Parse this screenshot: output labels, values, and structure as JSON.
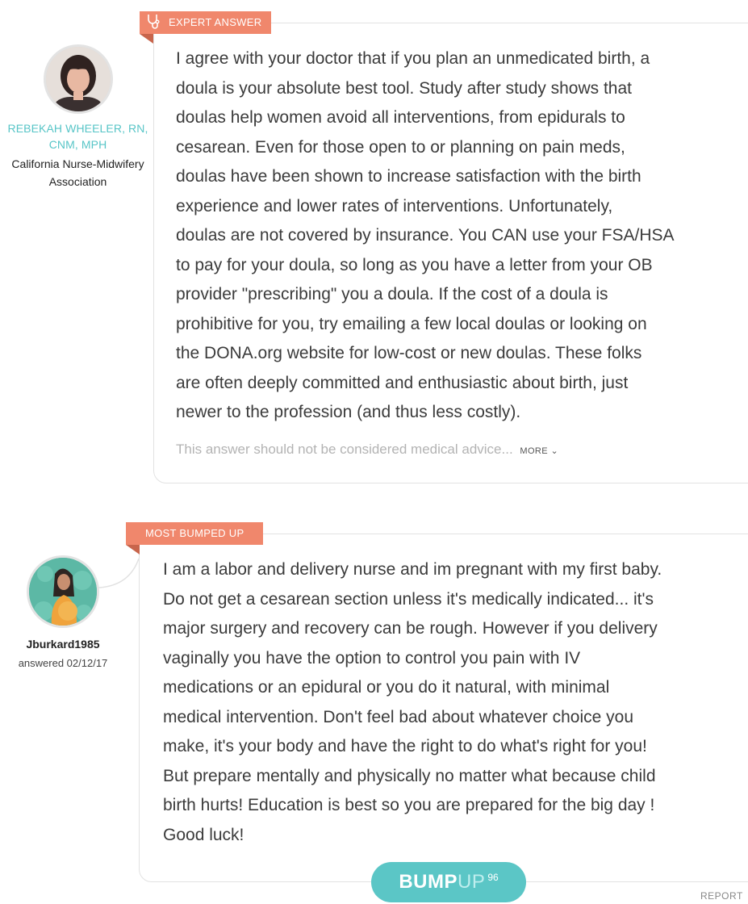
{
  "answer1": {
    "badge": "EXPERT ANSWER",
    "badge_icon": "stethoscope-icon",
    "author_name": "REBEKAH WHEELER, RN, CNM, MPH",
    "author_org": "California Nurse-Midwifery Association",
    "body": "I agree with your doctor that if you plan an unmedicated birth, a\ndoula is your absolute best tool.  Study after study shows that\ndoulas help women avoid all interventions, from epidurals to\ncesarean.  Even for those open to or planning on pain meds,\ndoulas have been shown to increase satisfaction with the birth\nexperience and lower rates of interventions.  Unfortunately,\ndoulas are not covered by insurance.  You CAN use your FSA/HSA\nto pay for your doula, so long as you have a letter from your OB\nprovider \"prescribing\" you a doula.  If the cost of a doula is\nprohibitive for you, try emailing a few local doulas or looking on\nthe DONA.org website for low-cost or new doulas.  These folks\nare often deeply committed and enthusiastic about birth, just\nnewer to the profession (and thus less costly).",
    "disclaimer": "This answer should not be considered medical advice...",
    "more_label": "MORE"
  },
  "answer2": {
    "badge": "MOST BUMPED UP",
    "author_name": "Jburkard1985",
    "answered_date": "answered 02/12/17",
    "body": "I am a labor and delivery nurse and im pregnant with my first baby.\nDo not get a cesarean section unless it's medically indicated... it's\nmajor surgery and recovery can be rough. However if you delivery\nvaginally you have the option to control you pain with IV\nmedications or an epidural or you do it natural, with minimal\nmedical intervention. Don't feel bad about whatever choice you\nmake, it's your body and have the right to do what's right for you!\nBut prepare mentally and physically no matter what because child\nbirth hurts! Education is best so you are prepared for the big day !\nGood luck!",
    "bump_bold": "BUMP",
    "bump_light": "UP",
    "bump_count": "96",
    "report_label": "REPORT"
  },
  "colors": {
    "badge": "#f0876c",
    "accent_teal": "#57c5c7",
    "bump_button": "#5bc6c6"
  }
}
